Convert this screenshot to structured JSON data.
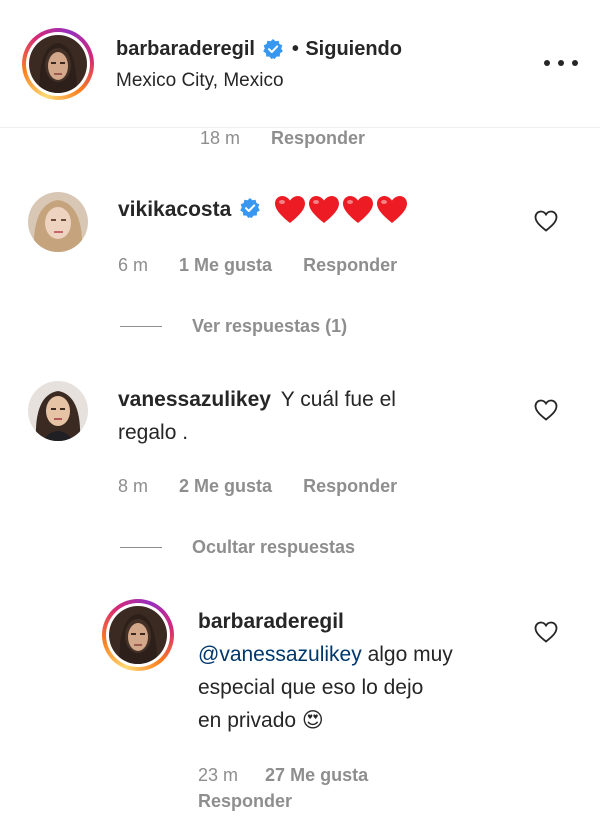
{
  "header": {
    "username": "barbaraderegil",
    "separator": "•",
    "follow_status": "Siguiendo",
    "location": "Mexico City, Mexico"
  },
  "top_partial": {
    "time": "18 m",
    "reply_label": "Responder"
  },
  "comments": [
    {
      "username": "vikikacosta",
      "verified": true,
      "text": "",
      "emoji": "❤️❤️❤️❤️",
      "time": "6 m",
      "likes": "1 Me gusta",
      "reply_label": "Responder",
      "replies_toggle": "Ver respuestas (1)"
    },
    {
      "username": "vanessazulikey",
      "verified": false,
      "text_line1": "Y cuál fue el",
      "text_line2": "regalo .",
      "time": "8 m",
      "likes": "2 Me gusta",
      "reply_label": "Responder",
      "replies_toggle": "Ocultar respuestas"
    }
  ],
  "reply": {
    "username": "barbaraderegil",
    "mention": "@vanessazulikey",
    "text_line1": " algo muy",
    "text_line2": "especial que eso lo dejo",
    "text_line3": "en privado",
    "emoji": "😍",
    "time": "23 m",
    "likes": "27 Me gusta",
    "reply_label": "Responder"
  },
  "colors": {
    "verified_badge": "#3897f0",
    "heart_red": "#ed1c24",
    "secondary_text": "#8e8e8e",
    "mention_link": "#00376b"
  }
}
